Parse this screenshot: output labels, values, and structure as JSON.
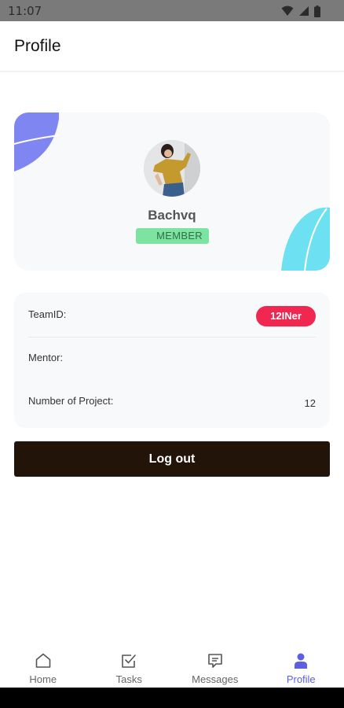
{
  "status_bar": {
    "time": "11:07"
  },
  "header": {
    "title": "Profile"
  },
  "profile": {
    "name": "Bachvq",
    "role": "MEMBER"
  },
  "info": {
    "team_label": "TeamID:",
    "team_value": "12INer",
    "mentor_label": "Mentor:",
    "mentor_value": "",
    "projects_label": "Number of Project:",
    "projects_value": "12"
  },
  "actions": {
    "logout_label": "Log out"
  },
  "bottom_nav": {
    "items": [
      {
        "label": "Home",
        "icon": "home-icon",
        "active": false
      },
      {
        "label": "Tasks",
        "icon": "tasks-icon",
        "active": false
      },
      {
        "label": "Messages",
        "icon": "messages-icon",
        "active": false
      },
      {
        "label": "Profile",
        "icon": "person-icon",
        "active": true
      }
    ]
  },
  "colors": {
    "accent": "#5b5fe2",
    "badge_team": "#ef2751",
    "badge_role": "#7ce3a1",
    "logout_button": "#23140a",
    "blob_purple": "#7f86f2",
    "blob_cyan": "#6de0f2"
  }
}
